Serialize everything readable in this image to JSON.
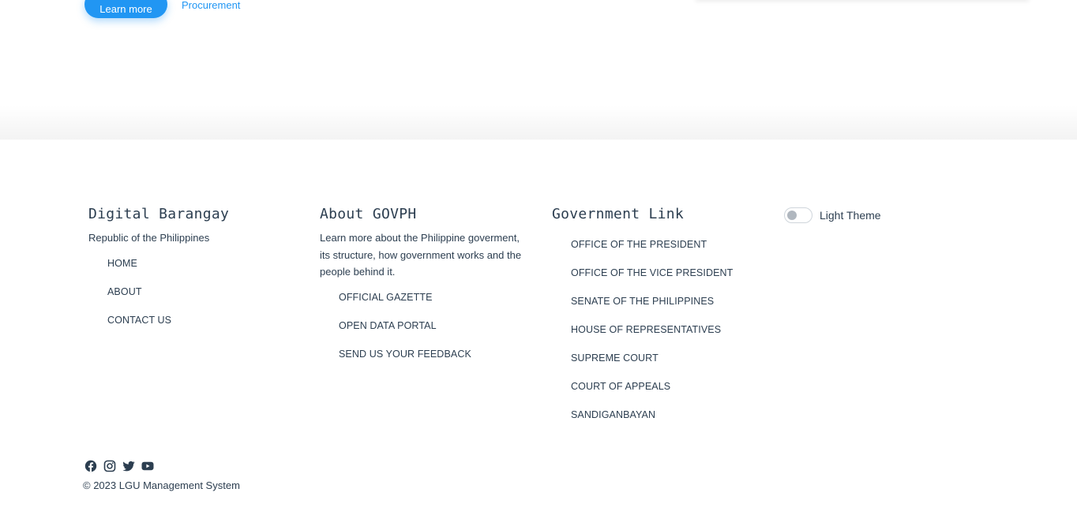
{
  "hero": {
    "learn_more_label": "Learn more",
    "procurement_label": "Procurement"
  },
  "footer": {
    "brand": {
      "title": "Digital Barangay",
      "subtitle": "Republic of the Philippines",
      "links": [
        "HOME",
        "ABOUT",
        "CONTACT US"
      ]
    },
    "about": {
      "title": "About GOVPH",
      "description": "Learn more about the Philippine goverment, its structure, how government works and the people behind it.",
      "links": [
        "OFFICIAL GAZETTE",
        "OPEN DATA PORTAL",
        "SEND US YOUR FEEDBACK"
      ]
    },
    "gov_links": {
      "title": "Government Link",
      "links": [
        "OFFICE OF THE PRESIDENT",
        "OFFICE OF THE VICE PRESIDENT",
        "SENATE OF THE PHILIPPINES",
        "HOUSE OF REPRESENTATIVES",
        "SUPREME COURT",
        "COURT OF APPEALS",
        "SANDIGANBAYAN"
      ]
    },
    "theme": {
      "label": "Light Theme",
      "enabled": false
    },
    "social_icons": [
      "facebook-icon",
      "instagram-icon",
      "twitter-icon",
      "youtube-icon"
    ],
    "copyright": "© 2023 LGU Management System"
  },
  "colors": {
    "accent": "#2196f3",
    "text": "#2c3e50"
  }
}
